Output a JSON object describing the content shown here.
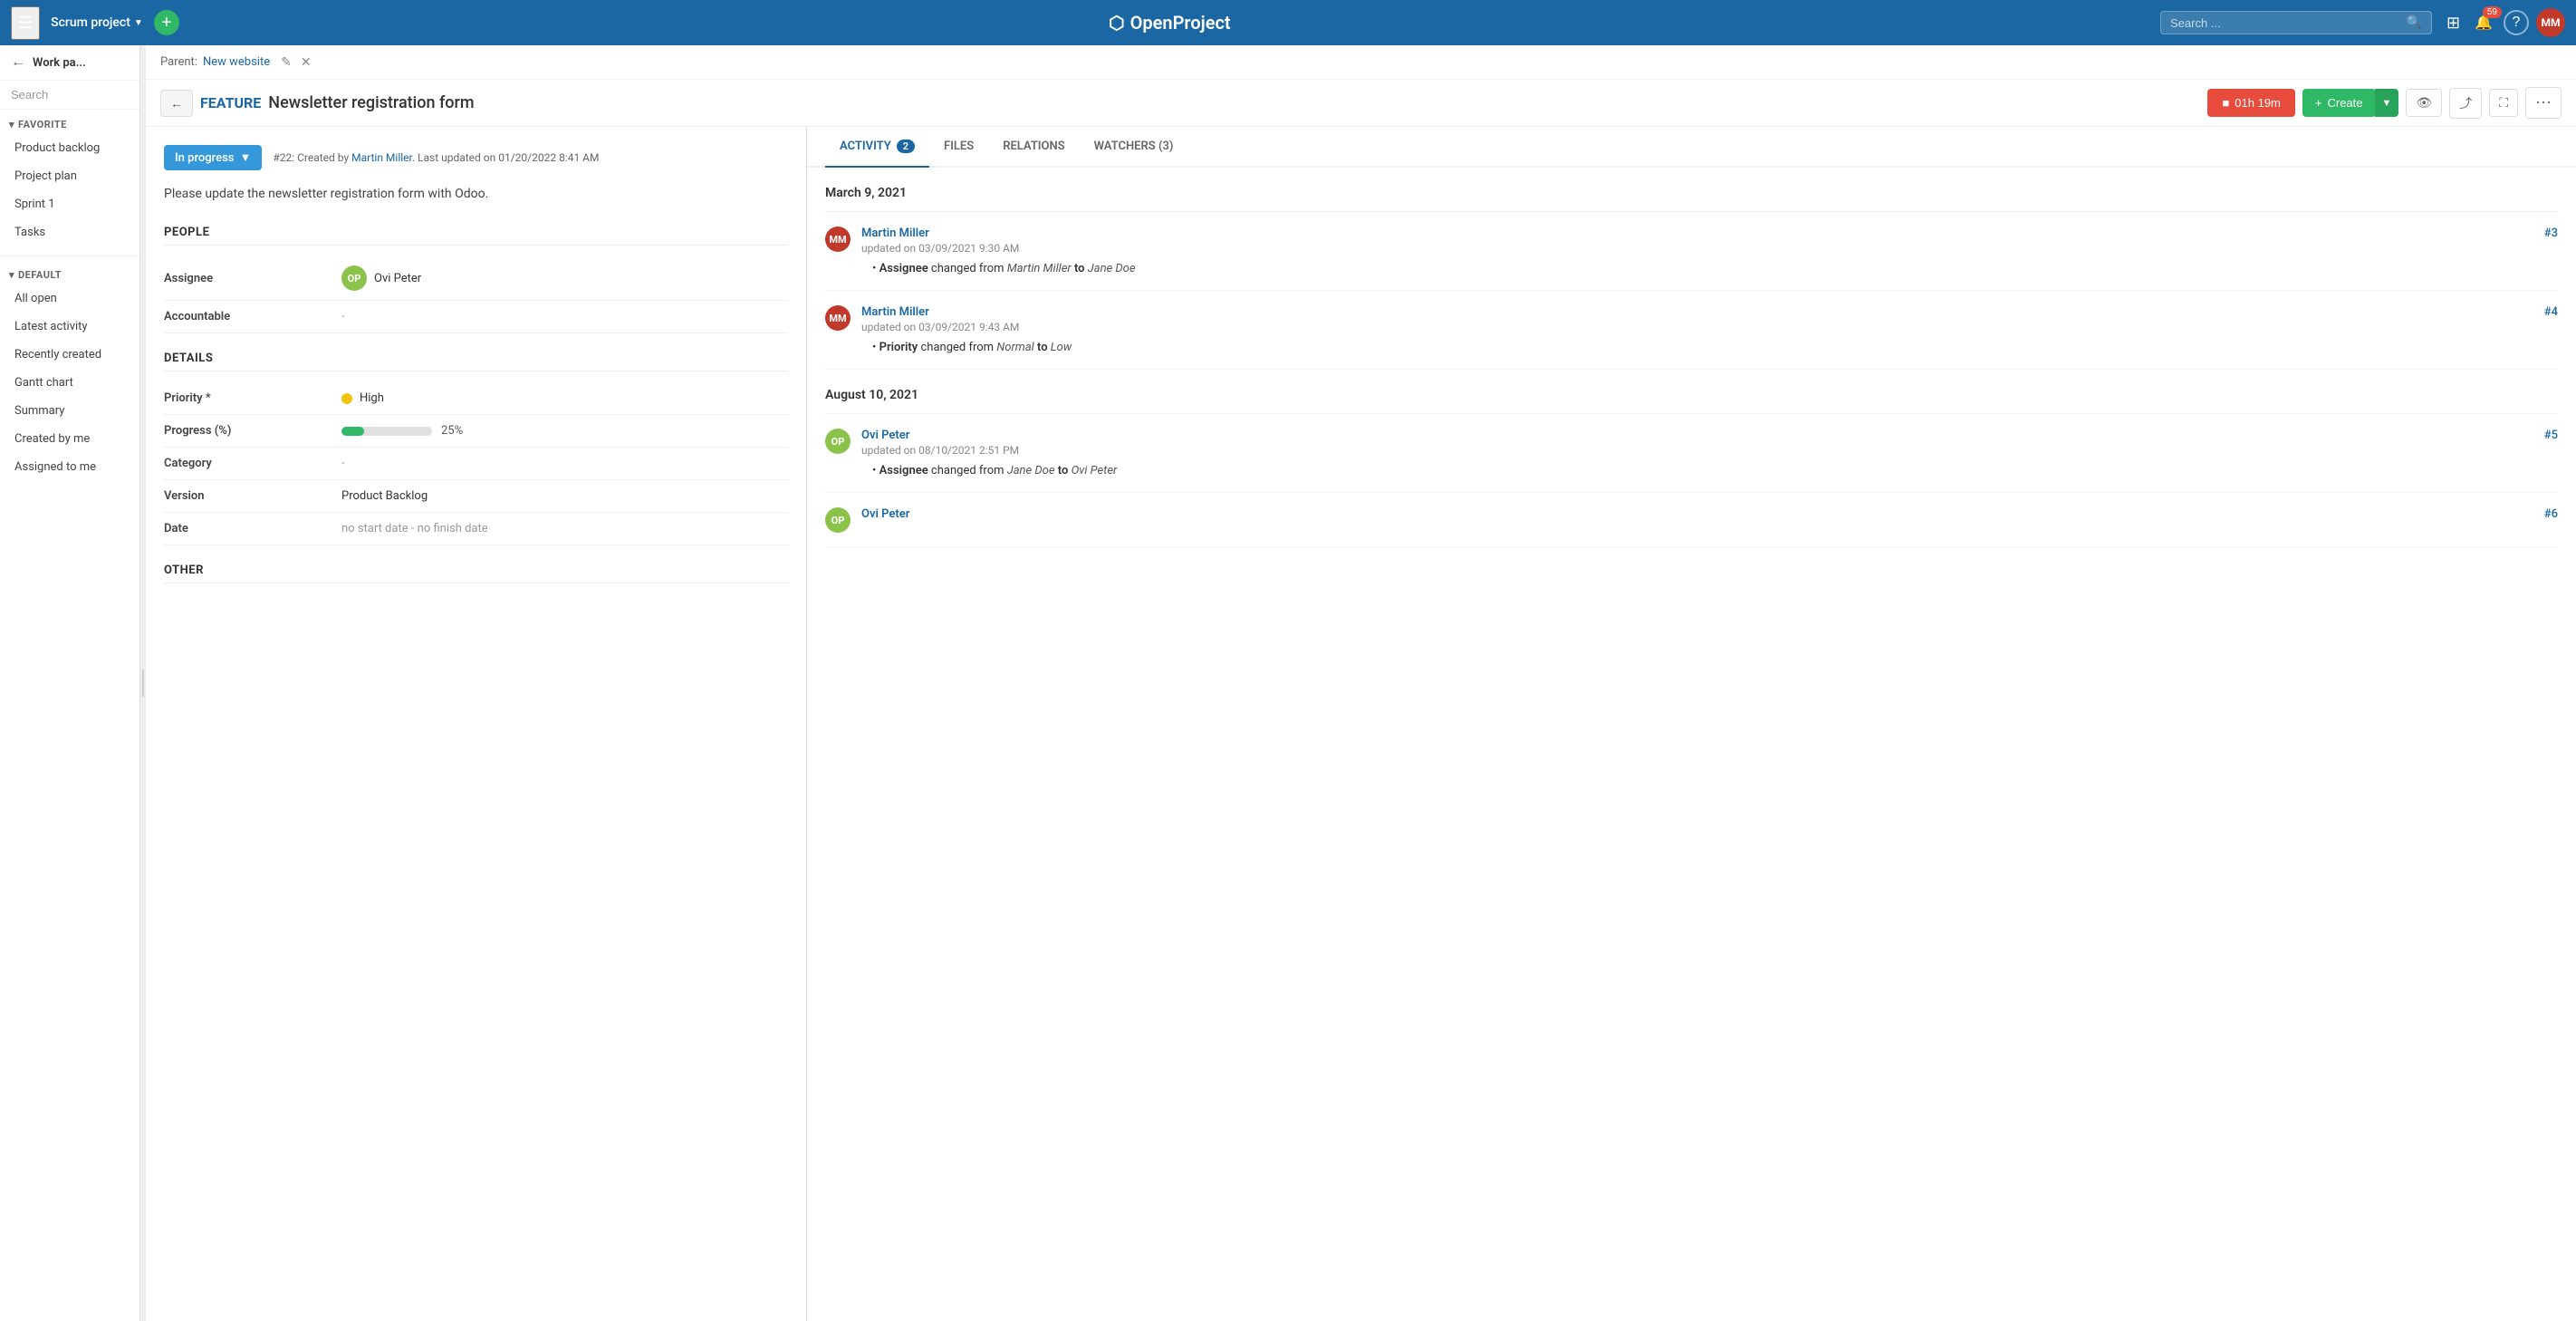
{
  "topbar": {
    "menu_icon": "☰",
    "project_name": "Scrum project",
    "project_arrow": "▼",
    "add_btn": "+",
    "logo_text": "OpenProject",
    "search_placeholder": "Search ...",
    "search_icon": "🔍",
    "grid_icon": "⊞",
    "notifications_count": "59",
    "help_icon": "?",
    "avatar_initials": "MM"
  },
  "sidebar": {
    "back_icon": "←",
    "title": "Work pa...",
    "search_placeholder": "Search",
    "search_icon": "🔍",
    "favorite_section": {
      "label": "FAVORITE",
      "arrow": "▾",
      "items": [
        {
          "id": "product-backlog",
          "label": "Product backlog",
          "active": false
        },
        {
          "id": "project-plan",
          "label": "Project plan",
          "active": false
        },
        {
          "id": "sprint-1",
          "label": "Sprint 1",
          "active": false
        },
        {
          "id": "tasks",
          "label": "Tasks",
          "active": false
        }
      ]
    },
    "default_section": {
      "label": "DEFAULT",
      "arrow": "▾",
      "items": [
        {
          "id": "all-open",
          "label": "All open",
          "active": false
        },
        {
          "id": "latest-activity",
          "label": "Latest activity",
          "active": false
        },
        {
          "id": "recently-created",
          "label": "Recently created",
          "active": false
        },
        {
          "id": "gantt-chart",
          "label": "Gantt chart",
          "active": false
        },
        {
          "id": "summary",
          "label": "Summary",
          "active": false
        },
        {
          "id": "created-by-me",
          "label": "Created by me",
          "active": false
        },
        {
          "id": "assigned-to-me",
          "label": "Assigned to me",
          "active": false
        }
      ]
    }
  },
  "breadcrumb": {
    "parent_label": "Parent:",
    "parent_link": "New website",
    "edit_icon": "✎",
    "close_icon": "✕"
  },
  "toolbar": {
    "back_icon": "←",
    "type_label": "FEATURE",
    "title": "Newsletter registration form",
    "timer_icon": "■",
    "timer_label": "01h 19m",
    "create_icon": "+",
    "create_label": "Create",
    "create_arrow": "▼",
    "watch_icon": "👁",
    "share_icon": "⤴",
    "fullscreen_icon": "⛶",
    "more_icon": "⋯"
  },
  "work_item": {
    "status": "In progress",
    "status_arrow": "▼",
    "id": "#22",
    "created_by": "Martin Miller",
    "last_updated": "01/20/2022 8:41 AM",
    "description": "Please update the newsletter registration form with Odoo.",
    "people_section": "PEOPLE",
    "assignee_label": "Assignee",
    "assignee_name": "Ovi Peter",
    "assignee_initials": "OP",
    "accountable_label": "Accountable",
    "accountable_value": "-",
    "details_section": "DETAILS",
    "priority_label": "Priority *",
    "priority_value": "High",
    "progress_label": "Progress (%)",
    "progress_value": 25,
    "progress_text": "25%",
    "category_label": "Category",
    "category_value": "-",
    "version_label": "Version",
    "version_value": "Product Backlog",
    "date_label": "Date",
    "date_value": "no start date - no finish date",
    "other_section": "OTHER"
  },
  "tabs": {
    "activity_label": "ACTIVITY",
    "activity_count": "2",
    "files_label": "FILES",
    "relations_label": "RELATIONS",
    "watchers_label": "WATCHERS (3)"
  },
  "activity": {
    "dates": [
      {
        "date": "March 9, 2021",
        "entries": [
          {
            "id": "#3",
            "author": "Martin Miller",
            "author_initials": "MM",
            "time": "updated on 03/09/2021 9:30 AM",
            "changes": [
              {
                "field": "Assignee",
                "action": "changed from",
                "from": "Martin Miller",
                "to": "Jane Doe"
              }
            ]
          },
          {
            "id": "#4",
            "author": "Martin Miller",
            "author_initials": "MM",
            "time": "updated on 03/09/2021 9:43 AM",
            "changes": [
              {
                "field": "Priority",
                "action": "changed from",
                "from": "Normal",
                "to": "Low"
              }
            ]
          }
        ]
      },
      {
        "date": "August 10, 2021",
        "entries": [
          {
            "id": "#5",
            "author": "Ovi Peter",
            "author_initials": "OP",
            "time": "updated on 08/10/2021 2:51 PM",
            "changes": [
              {
                "field": "Assignee",
                "action": "changed from",
                "from": "Jane Doe",
                "to": "Ovi Peter"
              }
            ]
          },
          {
            "id": "#6",
            "author": "Ovi Peter",
            "author_initials": "OP",
            "time": "",
            "changes": []
          }
        ]
      }
    ]
  }
}
